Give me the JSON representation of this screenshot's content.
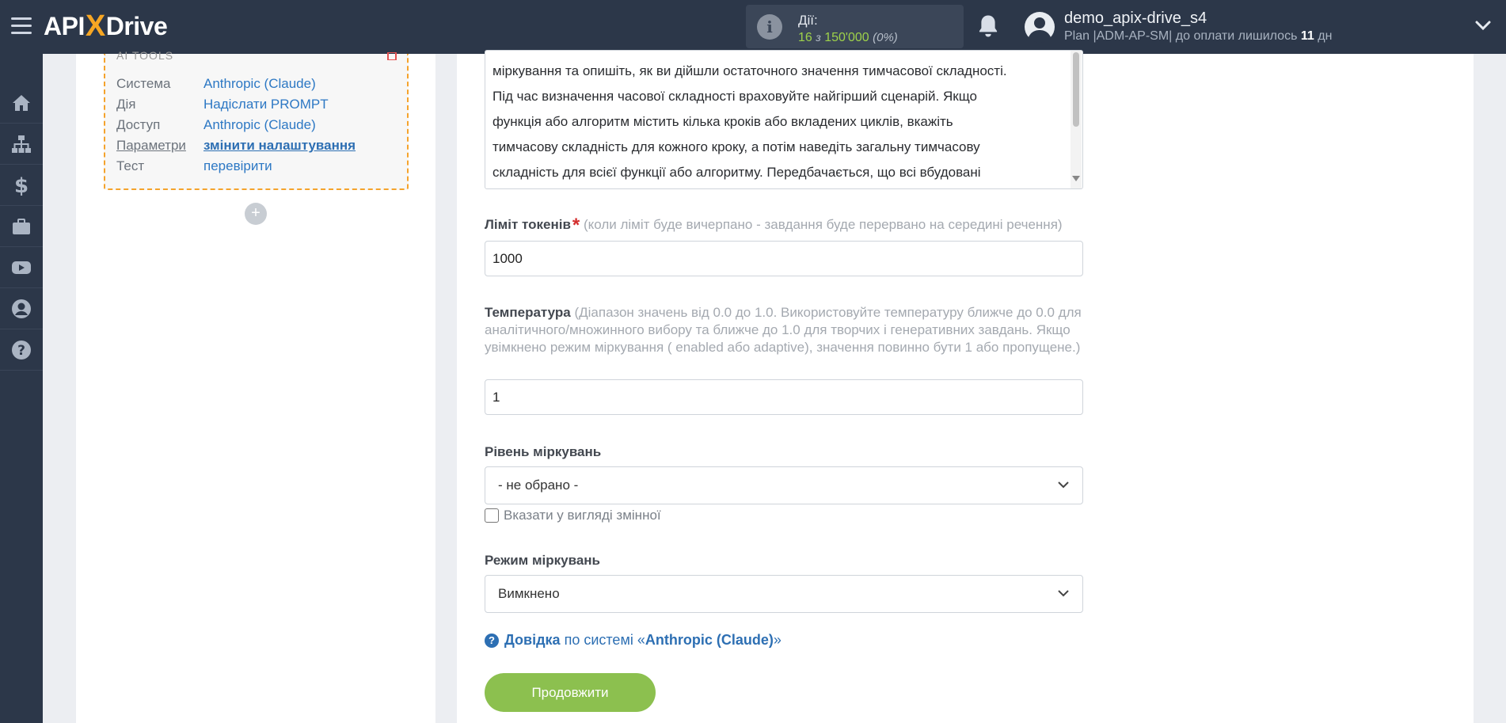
{
  "header": {
    "logo": {
      "part1": "API",
      "part2": "X",
      "part3": "Drive"
    },
    "actions": {
      "label": "Дії:",
      "used": "16",
      "of_word": "з",
      "total": "150'000",
      "percent": "(0%)"
    },
    "user": {
      "name": "demo_apix-drive_s4",
      "plan_prefix": "Plan |ADM-AP-SM| до оплати лишилось",
      "days": "11",
      "days_suffix": "дн"
    }
  },
  "sidebar": {
    "items": [
      {
        "icon": "home-icon"
      },
      {
        "icon": "sitemap-icon"
      },
      {
        "icon": "dollar-icon"
      },
      {
        "icon": "briefcase-icon"
      },
      {
        "icon": "youtube-icon"
      },
      {
        "icon": "user-circle-icon"
      },
      {
        "icon": "question-icon"
      }
    ]
  },
  "card": {
    "title": "AI TOOLS",
    "rows": [
      {
        "key": "Система",
        "value": "Anthropic (Claude)"
      },
      {
        "key": "Дія",
        "value": "Надіслати PROMPT"
      },
      {
        "key": "Доступ",
        "value": "Anthropic (Claude)"
      },
      {
        "key": "Параметри",
        "value": "змінити налаштування"
      },
      {
        "key": "Тест",
        "value": "перевірити"
      }
    ],
    "add_label": "+"
  },
  "form": {
    "prompt_lines": [
      "міркування та опишіть, як ви дійшли остаточного значення тимчасової складності.",
      "Під час визначення часової складності враховуйте найгірший сценарій. Якщо",
      "функція або алгоритм містить кілька кроків або вкладених циклів, вкажіть",
      "тимчасову складність для кожного кроку, а потім наведіть загальну тимчасову",
      "складність для всієї функції або алгоритму. Передбачається, що всі вбудовані"
    ],
    "token_limit": {
      "label": "Ліміт токенів",
      "required": "*",
      "hint": "(коли ліміт буде вичерпано - завдання буде перервано на середині речення)",
      "value": "1000"
    },
    "temperature": {
      "label": "Температура",
      "hint": "(Діапазон значень від 0.0 до 1.0. Використовуйте температуру ближче до 0.0 для аналітичного/множинного вибору та ближче до 1.0 для творчих і генеративних завдань. Якщо увімкнено режим міркування ( enabled або adaptive), значення повинно бути 1 або пропущене.)",
      "value": "1"
    },
    "reasoning_level": {
      "label": "Рівень міркувань",
      "selected": "- не обрано -",
      "checkbox_label": "Вказати у вигляді змінної"
    },
    "reasoning_mode": {
      "label": "Режим міркувань",
      "selected": "Вимкнено"
    },
    "help": {
      "link": "Довідка",
      "middle": "по системі «",
      "system": "Anthropic (Claude)",
      "end": "»"
    },
    "continue_label": "Продовжити"
  },
  "colors": {
    "header_bg": "#2c3749",
    "accent_orange": "#f7a623",
    "link_blue": "#2d78c4",
    "continue_green": "#8cc04f",
    "actions_green": "#9ed14a"
  }
}
